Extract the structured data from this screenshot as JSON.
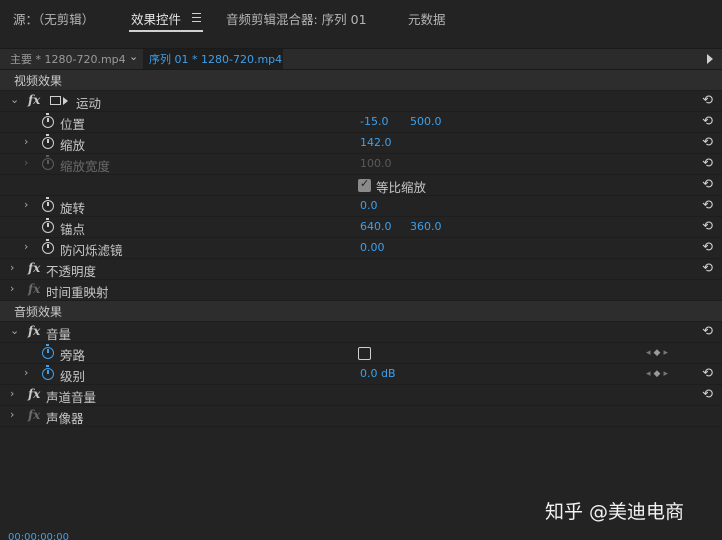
{
  "tabs": [
    {
      "label": "源：（无剪辑）"
    },
    {
      "label": "效果控件"
    },
    {
      "label": "音频剪辑混合器: 序列 01"
    },
    {
      "label": "元数据"
    }
  ],
  "sequence_bar": {
    "master": "主要 * 1280-720.mp4",
    "sequence": "序列 01 * 1280-720.mp4"
  },
  "video_section": {
    "label": "视频效果"
  },
  "motion": {
    "label": "运动",
    "position": {
      "label": "位置",
      "x": "-15.0",
      "y": "500.0"
    },
    "scale": {
      "label": "缩放",
      "value": "142.0"
    },
    "scale_width": {
      "label": "缩放宽度",
      "value": "100.0"
    },
    "uniform_scale": {
      "label": "等比缩放",
      "checked": true
    },
    "rotation": {
      "label": "旋转",
      "value": "0.0"
    },
    "anchor": {
      "label": "锚点",
      "x": "640.0",
      "y": "360.0"
    },
    "anti_flicker": {
      "label": "防闪烁滤镜",
      "value": "0.00"
    }
  },
  "opacity": {
    "label": "不透明度"
  },
  "time_remap": {
    "label": "时间重映射"
  },
  "audio_section": {
    "label": "音频效果"
  },
  "volume": {
    "label": "音量",
    "bypass": {
      "label": "旁路",
      "checked": false
    },
    "level": {
      "label": "级别",
      "value": "0.0 dB"
    }
  },
  "channel_volume": {
    "label": "声道音量"
  },
  "panner": {
    "label": "声像器"
  },
  "watermark": "知乎 @美迪电商",
  "timecode": "00:00:00:00",
  "icons": {
    "fx": "fx",
    "reset": "⟲",
    "chevron": "›",
    "chevron_down": "⌄"
  }
}
